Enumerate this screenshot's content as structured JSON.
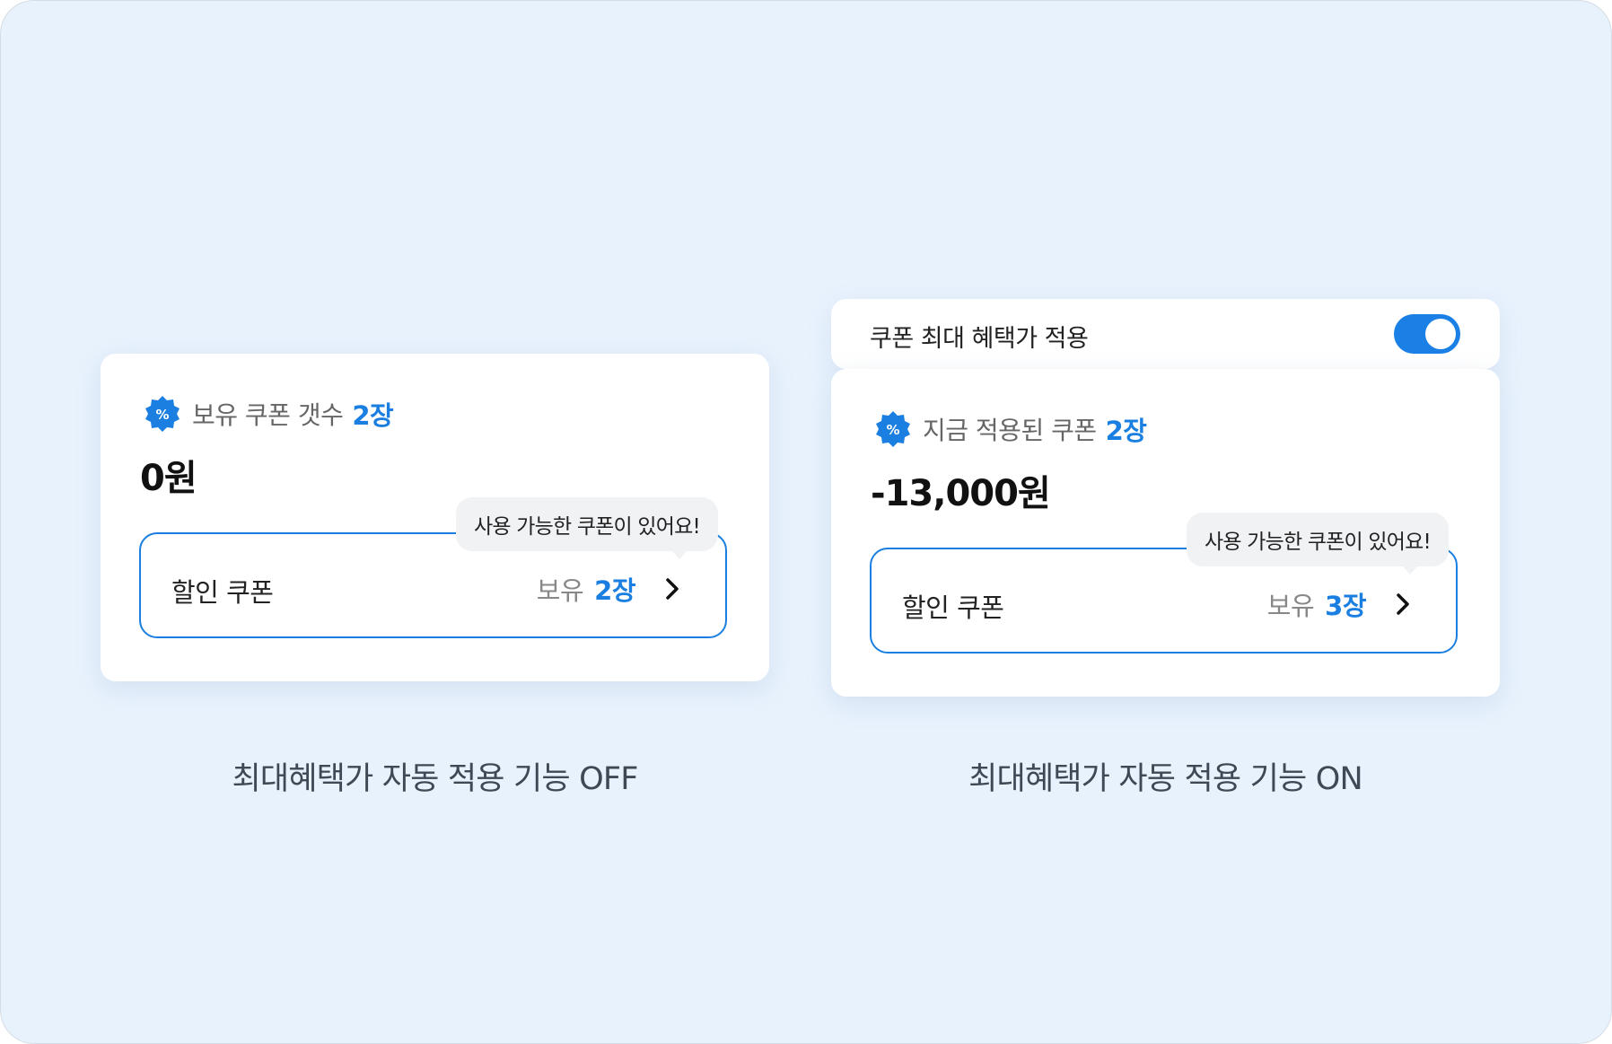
{
  "left_panel": {
    "header_text": "보유 쿠폰 갯수",
    "header_count": "2장",
    "amount": "0원",
    "tooltip": "사용 가능한 쿠폰이 있어요!",
    "coupon_label": "할인 쿠폰",
    "owned_label": "보유",
    "owned_count": "2장",
    "caption": "최대혜택가 자동 적용 기능 OFF"
  },
  "right_panel": {
    "toggle_label": "쿠폰 최대 혜택가 적용",
    "toggle_on": true,
    "header_text": "지금 적용된 쿠폰",
    "header_count": "2장",
    "amount": "-13,000원",
    "tooltip": "사용 가능한 쿠폰이 있어요!",
    "coupon_label": "할인 쿠폰",
    "owned_label": "보유",
    "owned_count": "3장",
    "caption": "최대혜택가 자동 적용 기능 ON"
  },
  "icons": {
    "coupon_badge": "percent-badge-icon",
    "arrow": "chevron-right-icon"
  },
  "colors": {
    "accent": "#1a7fe0",
    "background": "#e8f2fd",
    "toggle_on": "#1a80e6"
  }
}
